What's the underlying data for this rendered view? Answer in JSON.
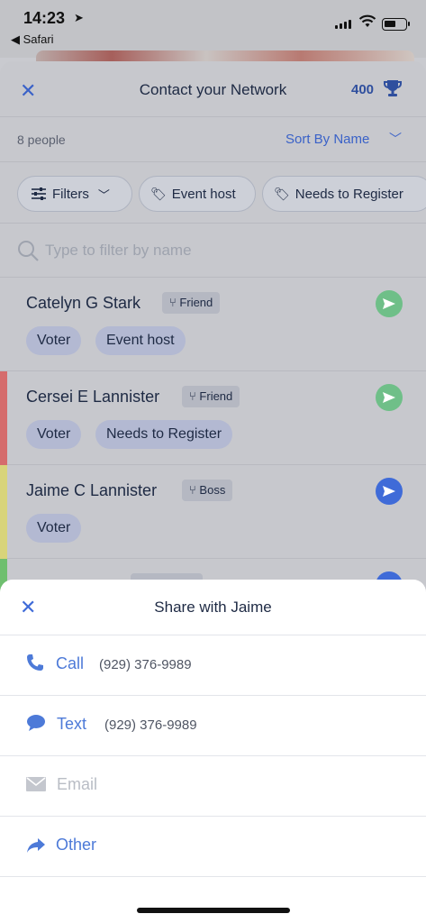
{
  "status_bar": {
    "time": "14:23",
    "back_app": "◀ Safari"
  },
  "header": {
    "close_icon": "close-icon",
    "title": "Contact your Network",
    "points": "400",
    "trophy_icon": "trophy-icon"
  },
  "meta": {
    "count": "8 people",
    "sort_label": "Sort By Name",
    "chevron": "chevron-down-icon"
  },
  "filters": {
    "filters_label": "Filters",
    "chips": [
      "Event host",
      "Needs to Register"
    ]
  },
  "search": {
    "placeholder": "Type to filter by name"
  },
  "contacts": [
    {
      "name": "Catelyn G Stark",
      "relation": "Friend",
      "tags": [
        "Voter",
        "Event host"
      ],
      "send_color": "#6fbf88",
      "bar_color": ""
    },
    {
      "name": "Cersei E Lannister",
      "relation": "Friend",
      "tags": [
        "Voter",
        "Needs to Register"
      ],
      "send_color": "#6fbf88",
      "bar_color": "#d56c6c"
    },
    {
      "name": "Jaime C Lannister",
      "relation": "Boss",
      "tags": [
        "Voter"
      ],
      "send_color": "#3f6bd8",
      "bar_color": "#d8d47a"
    }
  ],
  "sheet": {
    "title": "Share with Jaime",
    "options": [
      {
        "label": "Call",
        "number": "(929) 376-9989",
        "icon": "phone-icon",
        "enabled": true
      },
      {
        "label": "Text",
        "number": "(929) 376-9989",
        "icon": "chat-bubble-icon",
        "enabled": true
      },
      {
        "label": "Email",
        "number": "",
        "icon": "envelope-icon",
        "enabled": false
      },
      {
        "label": "Other",
        "number": "",
        "icon": "share-arrow-icon",
        "enabled": true
      }
    ]
  },
  "colors": {
    "accent": "#3f6bd8",
    "dim_bg": "#c7c8cd",
    "tag_bg": "#b3b9d2",
    "green_send": "#6fbf88",
    "red_bar": "#d56c6c",
    "yellow_bar": "#d8d47a",
    "green_bar": "#6fbf6f"
  }
}
